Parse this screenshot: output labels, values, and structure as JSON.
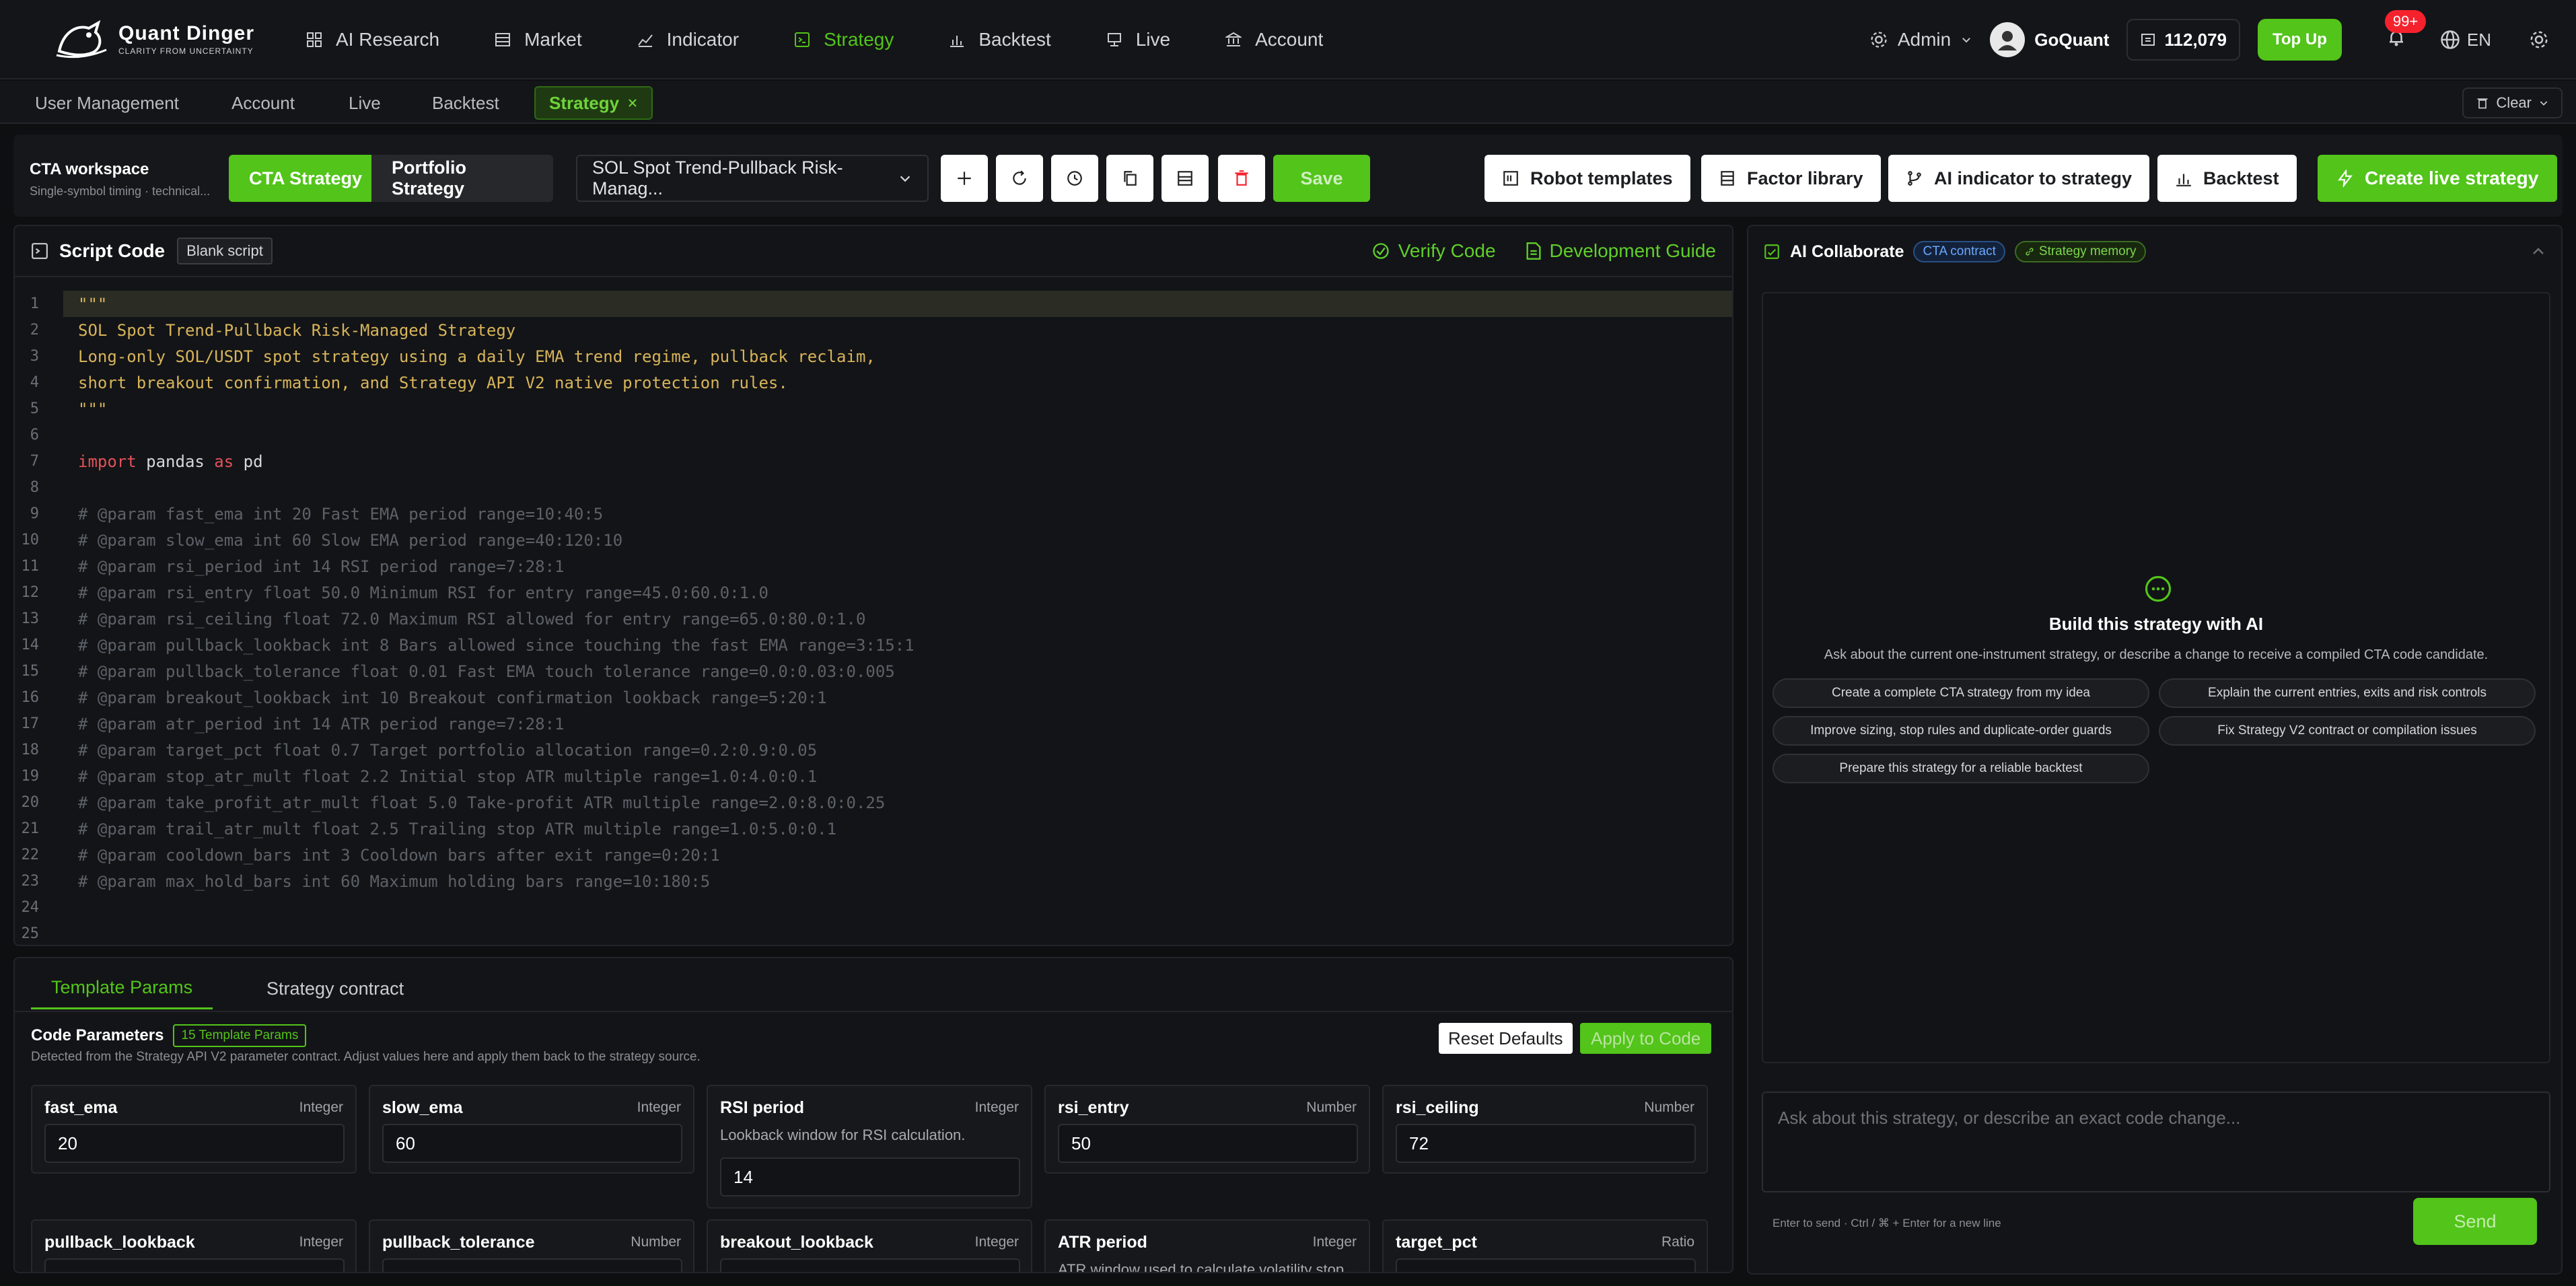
{
  "brand": {
    "name": "Quant Dinger",
    "tagline": "CLARITY FROM UNCERTAINTY"
  },
  "nav": [
    {
      "label": "AI Research",
      "icon": "grid-icon"
    },
    {
      "label": "Market",
      "icon": "market-icon"
    },
    {
      "label": "Indicator",
      "icon": "line-chart-icon"
    },
    {
      "label": "Strategy",
      "icon": "strategy-icon",
      "active": true
    },
    {
      "label": "Backtest",
      "icon": "bar-chart-icon"
    },
    {
      "label": "Live",
      "icon": "live-icon"
    },
    {
      "label": "Account",
      "icon": "bank-icon"
    }
  ],
  "header": {
    "admin": "Admin",
    "user": "GoQuant",
    "balance": "112,079",
    "topup": "Top Up",
    "notif_count": "99+",
    "lang": "EN"
  },
  "tabs": [
    {
      "label": "User Management"
    },
    {
      "label": "Account"
    },
    {
      "label": "Live"
    },
    {
      "label": "Backtest"
    },
    {
      "label": "Strategy",
      "active": true
    }
  ],
  "clear_label": "Clear",
  "toolbar": {
    "workspace_title": "CTA workspace",
    "workspace_sub": "Single-symbol timing · technical...",
    "mode_cta": "CTA Strategy",
    "mode_portfolio": "Portfolio Strategy",
    "selected_strategy": "SOL Spot Trend-Pullback Risk-Manag...",
    "save": "Save",
    "robot_templates": "Robot templates",
    "factor_library": "Factor library",
    "ai_indicator": "AI indicator to strategy",
    "backtest": "Backtest",
    "create_live": "Create live strategy"
  },
  "script": {
    "title": "Script Code",
    "blank": "Blank script",
    "verify": "Verify Code",
    "guide": "Development Guide",
    "lines": [
      {
        "n": "1",
        "t": "\"\"\"",
        "c": "str"
      },
      {
        "n": "2",
        "t": "SOL Spot Trend-Pullback Risk-Managed Strategy",
        "c": "str"
      },
      {
        "n": "3",
        "t": "Long-only SOL/USDT spot strategy using a daily EMA trend regime, pullback reclaim,",
        "c": "str"
      },
      {
        "n": "4",
        "t": "short breakout confirmation, and Strategy API V2 native protection rules.",
        "c": "str"
      },
      {
        "n": "5",
        "t": "\"\"\"",
        "c": "str"
      },
      {
        "n": "6",
        "t": "",
        "c": "pl"
      },
      {
        "n": "7",
        "t": "",
        "c": "imp",
        "a": "import",
        "b": " pandas ",
        "d": "as",
        "e": " pd"
      },
      {
        "n": "8",
        "t": "",
        "c": "pl"
      },
      {
        "n": "9",
        "t": "# @param fast_ema int 20 Fast EMA period range=10:40:5",
        "c": "cm"
      },
      {
        "n": "10",
        "t": "# @param slow_ema int 60 Slow EMA period range=40:120:10",
        "c": "cm"
      },
      {
        "n": "11",
        "t": "# @param rsi_period int 14 RSI period range=7:28:1",
        "c": "cm"
      },
      {
        "n": "12",
        "t": "# @param rsi_entry float 50.0 Minimum RSI for entry range=45.0:60.0:1.0",
        "c": "cm"
      },
      {
        "n": "13",
        "t": "# @param rsi_ceiling float 72.0 Maximum RSI allowed for entry range=65.0:80.0:1.0",
        "c": "cm"
      },
      {
        "n": "14",
        "t": "# @param pullback_lookback int 8 Bars allowed since touching the fast EMA range=3:15:1",
        "c": "cm"
      },
      {
        "n": "15",
        "t": "# @param pullback_tolerance float 0.01 Fast EMA touch tolerance range=0.0:0.03:0.005",
        "c": "cm"
      },
      {
        "n": "16",
        "t": "# @param breakout_lookback int 10 Breakout confirmation lookback range=5:20:1",
        "c": "cm"
      },
      {
        "n": "17",
        "t": "# @param atr_period int 14 ATR period range=7:28:1",
        "c": "cm"
      },
      {
        "n": "18",
        "t": "# @param target_pct float 0.7 Target portfolio allocation range=0.2:0.9:0.05",
        "c": "cm"
      },
      {
        "n": "19",
        "t": "# @param stop_atr_mult float 2.2 Initial stop ATR multiple range=1.0:4.0:0.1",
        "c": "cm"
      },
      {
        "n": "20",
        "t": "# @param take_profit_atr_mult float 5.0 Take-profit ATR multiple range=2.0:8.0:0.25",
        "c": "cm"
      },
      {
        "n": "21",
        "t": "# @param trail_atr_mult float 2.5 Trailing stop ATR multiple range=1.0:5.0:0.1",
        "c": "cm"
      },
      {
        "n": "22",
        "t": "# @param cooldown_bars int 3 Cooldown bars after exit range=0:20:1",
        "c": "cm"
      },
      {
        "n": "23",
        "t": "# @param max_hold_bars int 60 Maximum holding bars range=10:180:5",
        "c": "cm"
      },
      {
        "n": "24",
        "t": "",
        "c": "pl"
      },
      {
        "n": "25",
        "t": "",
        "c": "pl"
      }
    ]
  },
  "params": {
    "tab_template": "Template Params",
    "tab_contract": "Strategy contract",
    "title": "Code Parameters",
    "badge": "15 Template Params",
    "subtitle": "Detected from the Strategy API V2 parameter contract. Adjust values here and apply them back to the strategy source.",
    "reset": "Reset Defaults",
    "apply": "Apply to Code",
    "cards": [
      {
        "name": "fast_ema",
        "type": "Integer",
        "value": "20",
        "desc": ""
      },
      {
        "name": "slow_ema",
        "type": "Integer",
        "value": "60",
        "desc": ""
      },
      {
        "name": "RSI period",
        "type": "Integer",
        "value": "14",
        "desc": "Lookback window for RSI calculation."
      },
      {
        "name": "rsi_entry",
        "type": "Number",
        "value": "50",
        "desc": ""
      },
      {
        "name": "rsi_ceiling",
        "type": "Number",
        "value": "72",
        "desc": ""
      },
      {
        "name": "pullback_lookback",
        "type": "Integer",
        "value": "",
        "desc": ""
      },
      {
        "name": "pullback_tolerance",
        "type": "Number",
        "value": "",
        "desc": ""
      },
      {
        "name": "breakout_lookback",
        "type": "Integer",
        "value": "",
        "desc": ""
      },
      {
        "name": "ATR period",
        "type": "Integer",
        "value": "",
        "desc": "ATR window used to calculate volatility stop..."
      },
      {
        "name": "target_pct",
        "type": "Ratio",
        "value": "",
        "desc": ""
      }
    ]
  },
  "ai": {
    "title": "AI Collaborate",
    "tag_contract": "CTA contract",
    "tag_memory": "Strategy memory",
    "empty_title": "Build this strategy with AI",
    "empty_sub": "Ask about the current one-instrument strategy, or describe a change to receive a compiled CTA code candidate.",
    "chips": [
      "Create a complete CTA strategy from my idea",
      "Explain the current entries, exits and risk controls",
      "Improve sizing, stop rules and duplicate-order guards",
      "Fix Strategy V2 contract or compilation issues",
      "Prepare this strategy for a reliable backtest"
    ],
    "placeholder": "Ask about this strategy, or describe an exact code change...",
    "hint": "Enter to send · Ctrl / ⌘ + Enter for a new line",
    "send": "Send"
  }
}
